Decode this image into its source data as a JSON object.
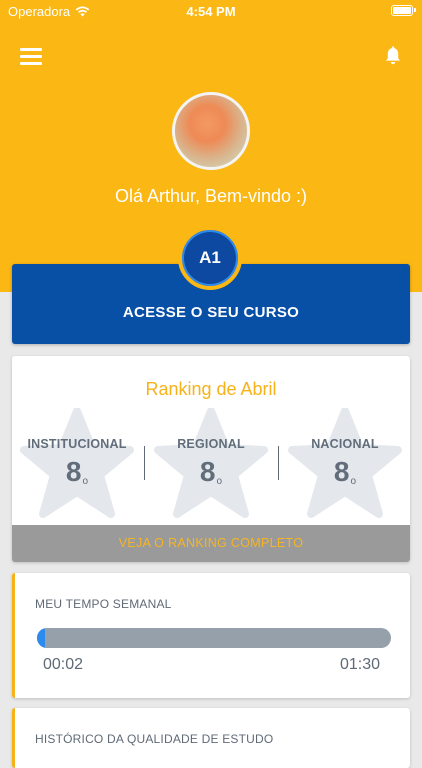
{
  "status_bar": {
    "carrier": "Operadora",
    "time": "4:54 PM"
  },
  "header": {
    "greeting": "Olá Arthur, Bem-vindo :)"
  },
  "course": {
    "level": "A1",
    "label": "ACESSE O SEU CURSO"
  },
  "ranking": {
    "title": "Ranking de Abril",
    "items": [
      {
        "label": "INSTITUCIONAL",
        "value": "8",
        "suffix": "o"
      },
      {
        "label": "REGIONAL",
        "value": "8",
        "suffix": "o"
      },
      {
        "label": "NACIONAL",
        "value": "8",
        "suffix": "o"
      }
    ],
    "footer": "VEJA O RANKING COMPLETO"
  },
  "weekly_time": {
    "heading": "MEU TEMPO SEMANAL",
    "current": "00:02",
    "goal": "01:30",
    "progress_fraction": 0.022
  },
  "history": {
    "heading": "HISTÓRICO DA QUALIDADE DE ESTUDO"
  },
  "colors": {
    "primary_yellow": "#fbb713",
    "primary_blue": "#084fa6",
    "accent_blue": "#2d8bf0",
    "text_gray": "#616d7a"
  },
  "icons": [
    "wifi-icon",
    "battery-icon",
    "menu-icon",
    "bell-icon",
    "star-icon"
  ]
}
